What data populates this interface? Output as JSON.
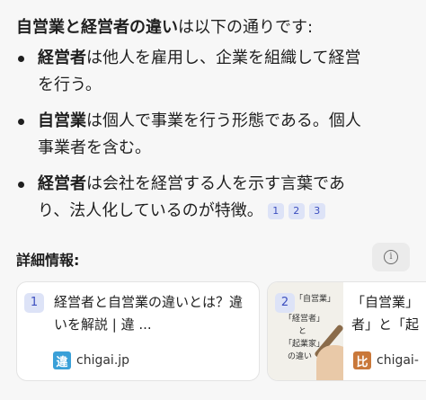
{
  "answer": {
    "intro_bold": "自営業と経営者の違い",
    "intro_rest": "は以下の通りです:",
    "bullets": [
      {
        "bold": "経営者",
        "line1": "は他人を雇用し、企業を組織して経営",
        "line2": "を行う。"
      },
      {
        "bold": "自営業",
        "line1": "は個人で事業を行う形態である。個人",
        "line2": "事業者を含む。"
      },
      {
        "bold": "経営者",
        "line1": "は会社を経営する人を示す言葉であ",
        "line2": "り、法人化しているのが特徴。",
        "citations": [
          "1",
          "2",
          "3"
        ]
      }
    ]
  },
  "details": {
    "heading": "詳細情報:",
    "info_icon": "info-icon"
  },
  "sources": [
    {
      "number": "1",
      "title": "経営者と自営業の違いとは？違いを解説 | 違 ...",
      "site": "chigai.jp",
      "favicon_char": "違",
      "favicon_color": "#3aa0d8"
    },
    {
      "number": "2",
      "title_line1": "「自営業」",
      "title_line2": "者」と「起",
      "site": "chigai-",
      "favicon_char": "比",
      "favicon_color": "#c9783a",
      "thumb_texts": [
        "「自営業」",
        "「経営者」",
        "と",
        "「起業家」",
        "の違い"
      ]
    }
  ]
}
